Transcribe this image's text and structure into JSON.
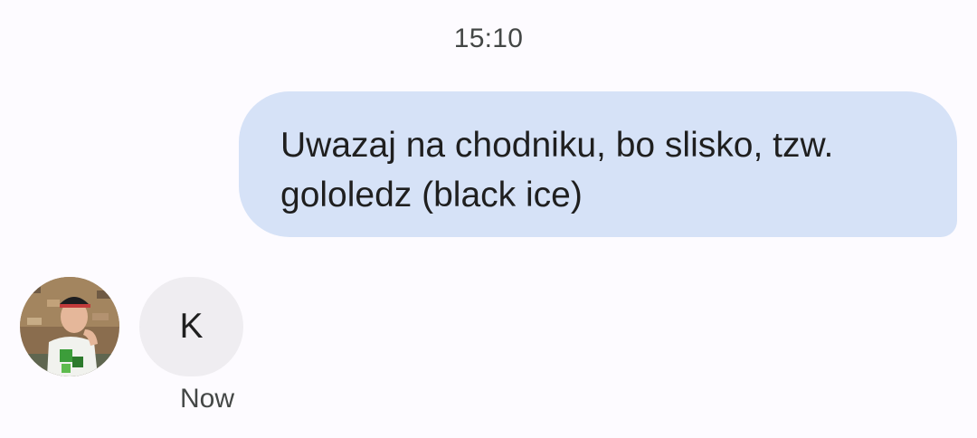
{
  "conversation": {
    "timestamp": "15:10",
    "outgoing_message": {
      "text": "Uwazaj na chodniku, bo slisko, tzw. gololedz (black ice)",
      "bubble_color": "#d6e2f7"
    },
    "incoming_message": {
      "avatar": "contact-photo",
      "text": "K",
      "bubble_color": "#efedf1",
      "time": "Now"
    }
  }
}
